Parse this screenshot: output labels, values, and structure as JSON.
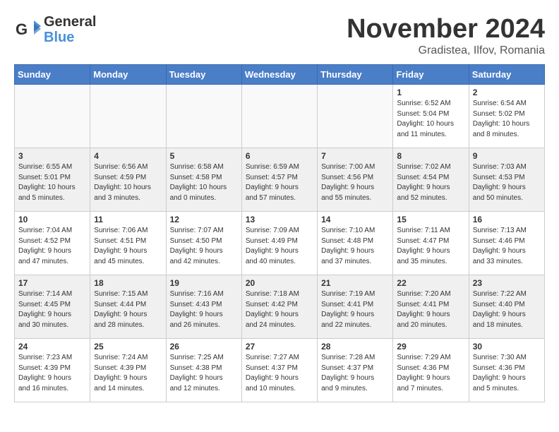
{
  "logo": {
    "line1": "General",
    "line2": "Blue"
  },
  "title": "November 2024",
  "location": "Gradistea, Ilfov, Romania",
  "weekdays": [
    "Sunday",
    "Monday",
    "Tuesday",
    "Wednesday",
    "Thursday",
    "Friday",
    "Saturday"
  ],
  "weeks": [
    [
      {
        "day": "",
        "info": ""
      },
      {
        "day": "",
        "info": ""
      },
      {
        "day": "",
        "info": ""
      },
      {
        "day": "",
        "info": ""
      },
      {
        "day": "",
        "info": ""
      },
      {
        "day": "1",
        "info": "Sunrise: 6:52 AM\nSunset: 5:04 PM\nDaylight: 10 hours\nand 11 minutes."
      },
      {
        "day": "2",
        "info": "Sunrise: 6:54 AM\nSunset: 5:02 PM\nDaylight: 10 hours\nand 8 minutes."
      }
    ],
    [
      {
        "day": "3",
        "info": "Sunrise: 6:55 AM\nSunset: 5:01 PM\nDaylight: 10 hours\nand 5 minutes."
      },
      {
        "day": "4",
        "info": "Sunrise: 6:56 AM\nSunset: 4:59 PM\nDaylight: 10 hours\nand 3 minutes."
      },
      {
        "day": "5",
        "info": "Sunrise: 6:58 AM\nSunset: 4:58 PM\nDaylight: 10 hours\nand 0 minutes."
      },
      {
        "day": "6",
        "info": "Sunrise: 6:59 AM\nSunset: 4:57 PM\nDaylight: 9 hours\nand 57 minutes."
      },
      {
        "day": "7",
        "info": "Sunrise: 7:00 AM\nSunset: 4:56 PM\nDaylight: 9 hours\nand 55 minutes."
      },
      {
        "day": "8",
        "info": "Sunrise: 7:02 AM\nSunset: 4:54 PM\nDaylight: 9 hours\nand 52 minutes."
      },
      {
        "day": "9",
        "info": "Sunrise: 7:03 AM\nSunset: 4:53 PM\nDaylight: 9 hours\nand 50 minutes."
      }
    ],
    [
      {
        "day": "10",
        "info": "Sunrise: 7:04 AM\nSunset: 4:52 PM\nDaylight: 9 hours\nand 47 minutes."
      },
      {
        "day": "11",
        "info": "Sunrise: 7:06 AM\nSunset: 4:51 PM\nDaylight: 9 hours\nand 45 minutes."
      },
      {
        "day": "12",
        "info": "Sunrise: 7:07 AM\nSunset: 4:50 PM\nDaylight: 9 hours\nand 42 minutes."
      },
      {
        "day": "13",
        "info": "Sunrise: 7:09 AM\nSunset: 4:49 PM\nDaylight: 9 hours\nand 40 minutes."
      },
      {
        "day": "14",
        "info": "Sunrise: 7:10 AM\nSunset: 4:48 PM\nDaylight: 9 hours\nand 37 minutes."
      },
      {
        "day": "15",
        "info": "Sunrise: 7:11 AM\nSunset: 4:47 PM\nDaylight: 9 hours\nand 35 minutes."
      },
      {
        "day": "16",
        "info": "Sunrise: 7:13 AM\nSunset: 4:46 PM\nDaylight: 9 hours\nand 33 minutes."
      }
    ],
    [
      {
        "day": "17",
        "info": "Sunrise: 7:14 AM\nSunset: 4:45 PM\nDaylight: 9 hours\nand 30 minutes."
      },
      {
        "day": "18",
        "info": "Sunrise: 7:15 AM\nSunset: 4:44 PM\nDaylight: 9 hours\nand 28 minutes."
      },
      {
        "day": "19",
        "info": "Sunrise: 7:16 AM\nSunset: 4:43 PM\nDaylight: 9 hours\nand 26 minutes."
      },
      {
        "day": "20",
        "info": "Sunrise: 7:18 AM\nSunset: 4:42 PM\nDaylight: 9 hours\nand 24 minutes."
      },
      {
        "day": "21",
        "info": "Sunrise: 7:19 AM\nSunset: 4:41 PM\nDaylight: 9 hours\nand 22 minutes."
      },
      {
        "day": "22",
        "info": "Sunrise: 7:20 AM\nSunset: 4:41 PM\nDaylight: 9 hours\nand 20 minutes."
      },
      {
        "day": "23",
        "info": "Sunrise: 7:22 AM\nSunset: 4:40 PM\nDaylight: 9 hours\nand 18 minutes."
      }
    ],
    [
      {
        "day": "24",
        "info": "Sunrise: 7:23 AM\nSunset: 4:39 PM\nDaylight: 9 hours\nand 16 minutes."
      },
      {
        "day": "25",
        "info": "Sunrise: 7:24 AM\nSunset: 4:39 PM\nDaylight: 9 hours\nand 14 minutes."
      },
      {
        "day": "26",
        "info": "Sunrise: 7:25 AM\nSunset: 4:38 PM\nDaylight: 9 hours\nand 12 minutes."
      },
      {
        "day": "27",
        "info": "Sunrise: 7:27 AM\nSunset: 4:37 PM\nDaylight: 9 hours\nand 10 minutes."
      },
      {
        "day": "28",
        "info": "Sunrise: 7:28 AM\nSunset: 4:37 PM\nDaylight: 9 hours\nand 9 minutes."
      },
      {
        "day": "29",
        "info": "Sunrise: 7:29 AM\nSunset: 4:36 PM\nDaylight: 9 hours\nand 7 minutes."
      },
      {
        "day": "30",
        "info": "Sunrise: 7:30 AM\nSunset: 4:36 PM\nDaylight: 9 hours\nand 5 minutes."
      }
    ]
  ],
  "shaded_weeks": [
    1,
    3
  ]
}
